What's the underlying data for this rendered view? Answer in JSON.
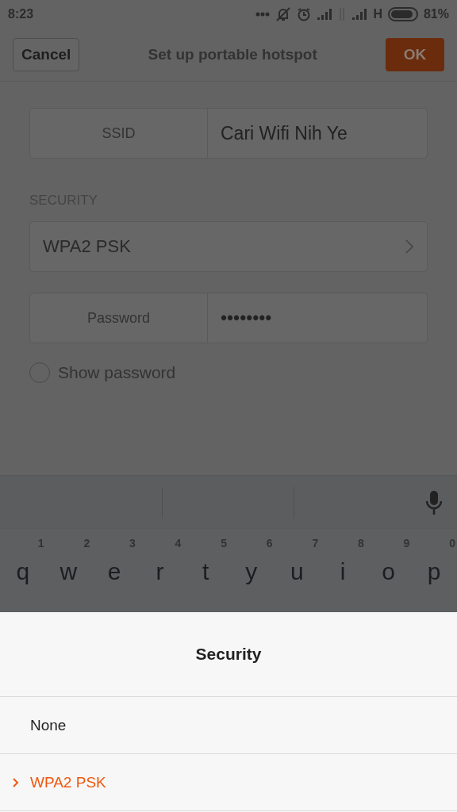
{
  "status_bar": {
    "time": "8:23",
    "network": "H",
    "battery": "81%"
  },
  "header": {
    "cancel": "Cancel",
    "title": "Set up portable hotspot",
    "ok": "OK"
  },
  "form": {
    "ssid": {
      "label": "SSID",
      "value": "Cari Wifi Nih Ye"
    },
    "security_label": "SECURITY",
    "security_value": "WPA2 PSK",
    "password": {
      "label": "Password",
      "value": "••••••••"
    },
    "show_password": {
      "label": "Show password",
      "checked": false
    }
  },
  "keyboard": {
    "keys": [
      {
        "hint": "1",
        "letter": "q"
      },
      {
        "hint": "2",
        "letter": "w"
      },
      {
        "hint": "3",
        "letter": "e"
      },
      {
        "hint": "4",
        "letter": "r"
      },
      {
        "hint": "5",
        "letter": "t"
      },
      {
        "hint": "6",
        "letter": "y"
      },
      {
        "hint": "7",
        "letter": "u"
      },
      {
        "hint": "8",
        "letter": "i"
      },
      {
        "hint": "9",
        "letter": "o"
      },
      {
        "hint": "0",
        "letter": "p"
      }
    ]
  },
  "sheet": {
    "title": "Security",
    "options": [
      {
        "label": "None",
        "selected": false
      },
      {
        "label": "WPA2 PSK",
        "selected": true
      }
    ]
  }
}
